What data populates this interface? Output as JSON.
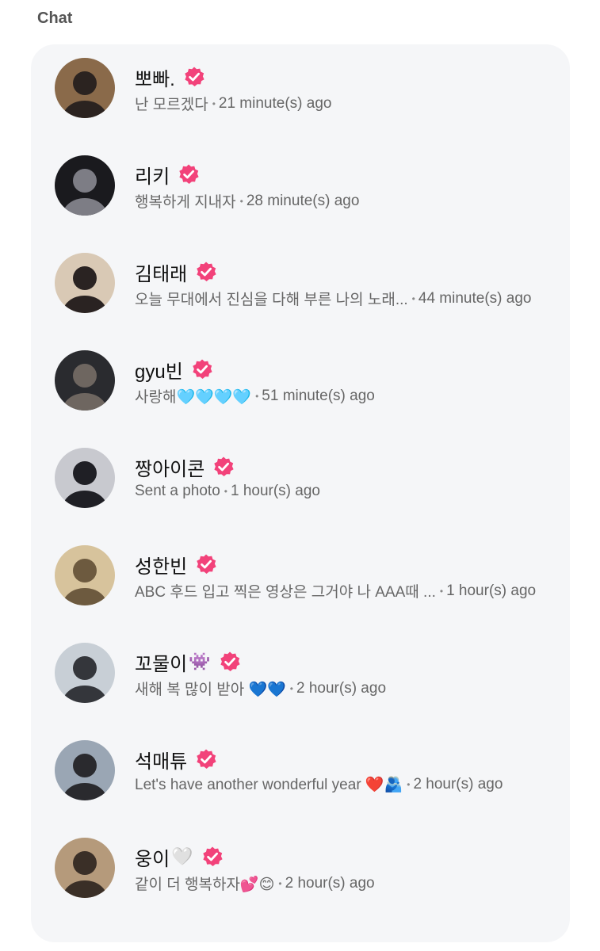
{
  "header": {
    "title": "Chat"
  },
  "colors": {
    "badge": "#f2427a",
    "panel": "#f5f6f8"
  },
  "chats": [
    {
      "name": "뽀빠.",
      "name_emoji": "",
      "preview": "난 모르겠다",
      "time": "21 minute(s) ago",
      "avatar_bg": "#8a6a4a",
      "avatar_fg": "#2b2320"
    },
    {
      "name": "리키",
      "name_emoji": "",
      "preview": "행복하게 지내자",
      "time": "28 minute(s) ago",
      "avatar_bg": "#1a1a1e",
      "avatar_fg": "#7d7d85"
    },
    {
      "name": "김태래",
      "name_emoji": "",
      "preview": "오늘 무대에서 진심을 다해 부른 나의 노래...",
      "time": "44 minute(s) ago",
      "avatar_bg": "#d9c9b5",
      "avatar_fg": "#2a2322"
    },
    {
      "name": "gyu빈",
      "name_emoji": "",
      "preview": "사랑해🩵🩵🩵🩵",
      "time": "51 minute(s) ago",
      "avatar_bg": "#2a2b2f",
      "avatar_fg": "#6e6660"
    },
    {
      "name": "짱아이콘",
      "name_emoji": "",
      "preview": "Sent a photo",
      "time": "1 hour(s) ago",
      "avatar_bg": "#c8c9cf",
      "avatar_fg": "#1f1f25"
    },
    {
      "name": "성한빈",
      "name_emoji": "",
      "preview": "ABC 후드 입고 찍은 영상은 그거야 나 AAA때 ...",
      "time": "1 hour(s) ago",
      "avatar_bg": "#d7c39c",
      "avatar_fg": "#6d5a3f"
    },
    {
      "name": "꼬물이",
      "name_emoji": "👾",
      "preview": "새해 복 많이 받아 💙💙",
      "time": "2 hour(s) ago",
      "avatar_bg": "#c8cfd6",
      "avatar_fg": "#34363b"
    },
    {
      "name": "석매튜",
      "name_emoji": "",
      "preview": "Let's have another wonderful year ❤️🫂",
      "time": "2 hour(s) ago",
      "avatar_bg": "#9aa6b4",
      "avatar_fg": "#2a2a2e"
    },
    {
      "name": "웅이",
      "name_emoji": "🤍",
      "preview": "같이 더 행복하자💕😊",
      "time": "2 hour(s) ago",
      "avatar_bg": "#b59a7b",
      "avatar_fg": "#3a2f27"
    }
  ]
}
